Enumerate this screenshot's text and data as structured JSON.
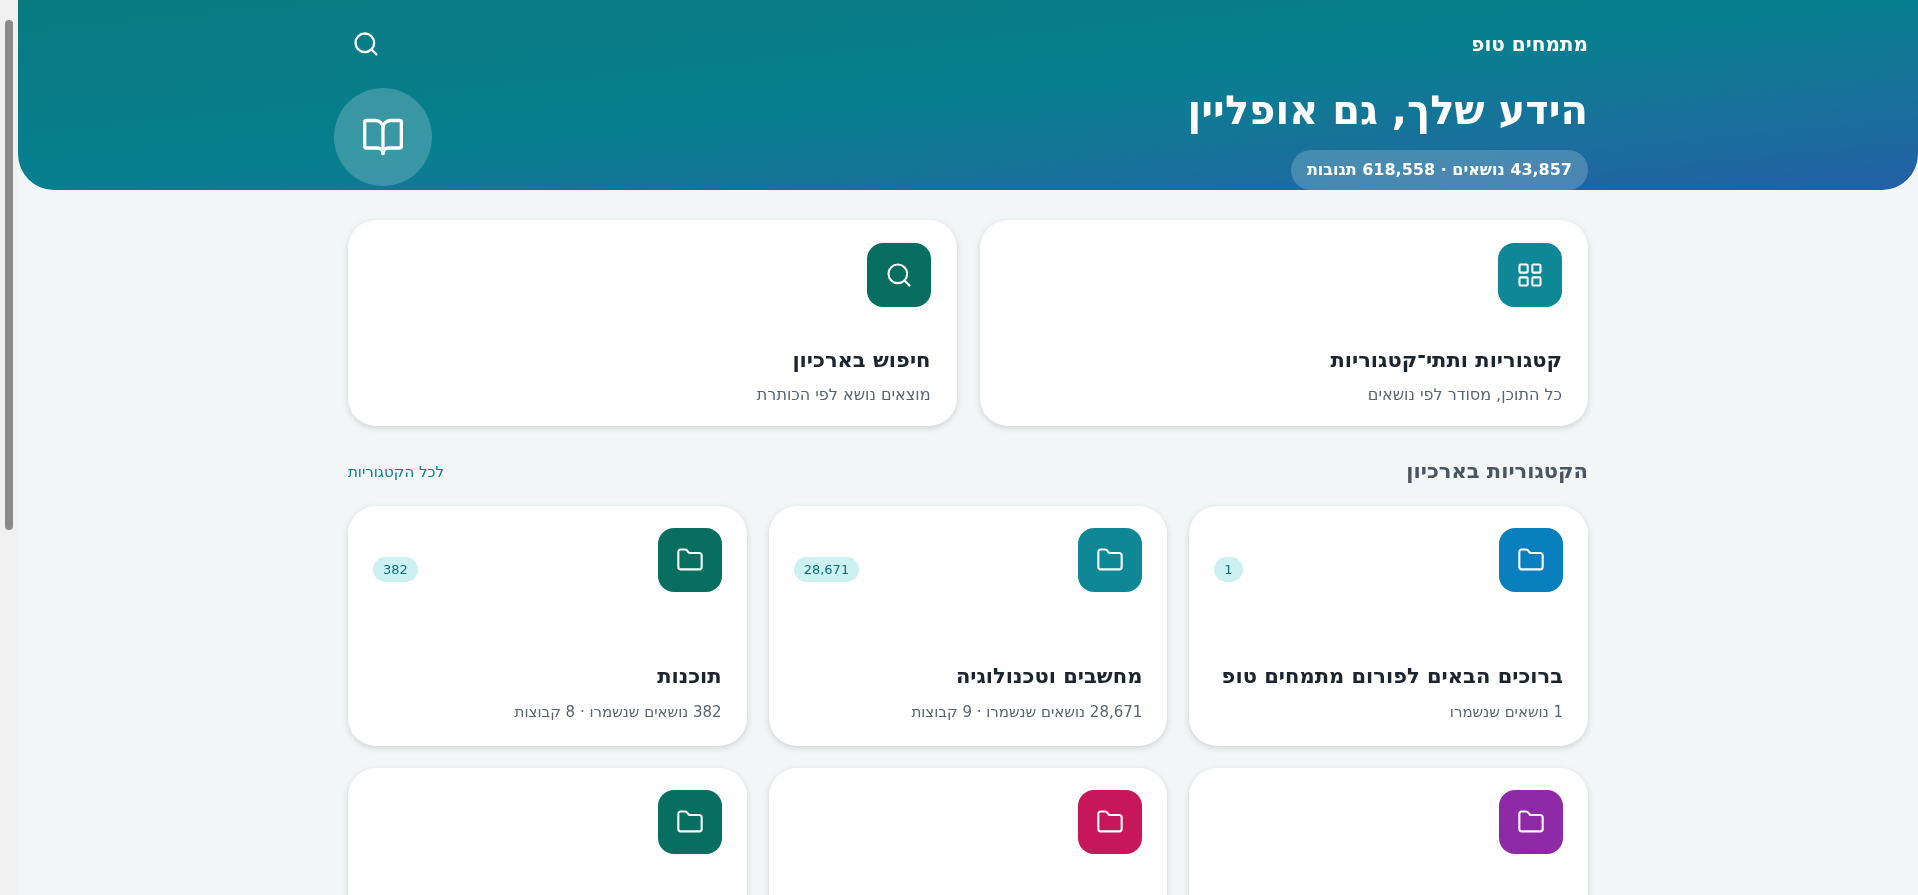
{
  "header": {
    "brand": "מתמחים טופ",
    "title": "הידע שלך, גם אופליין",
    "stats": "43,857 נושאים · 618,558 תגובות"
  },
  "quick_links": [
    {
      "kind": "grid",
      "title": "קטגוריות ותתי־קטגוריות",
      "subtitle": "כל התוכן, מסודר לפי נושאים",
      "color": "#0e8796"
    },
    {
      "kind": "search",
      "title": "חיפוש בארכיון",
      "subtitle": "מוצאים נושא לפי הכותרת",
      "color": "#086e5f"
    }
  ],
  "categories_section": {
    "heading": "הקטגוריות בארכיון",
    "link": "לכל הקטגוריות"
  },
  "categories": [
    {
      "title": "ברוכים הבאים לפורום מתמחים טופ",
      "meta": "1 נושאים שנשמרו",
      "count": "1",
      "color": "#0a7fbd"
    },
    {
      "title": "מחשבים וטכנולוגיה",
      "meta": "28,671 נושאים שנשמרו · 9 קבוצות",
      "count": "28,671",
      "color": "#0e8796"
    },
    {
      "title": "תוכנות",
      "meta": "382 נושאים שנשמרו · 8 קבוצות",
      "count": "382",
      "color": "#086e5f"
    },
    {
      "color": "#8e2aa6"
    },
    {
      "color": "#c8165a"
    },
    {
      "color": "#086e5f"
    }
  ]
}
